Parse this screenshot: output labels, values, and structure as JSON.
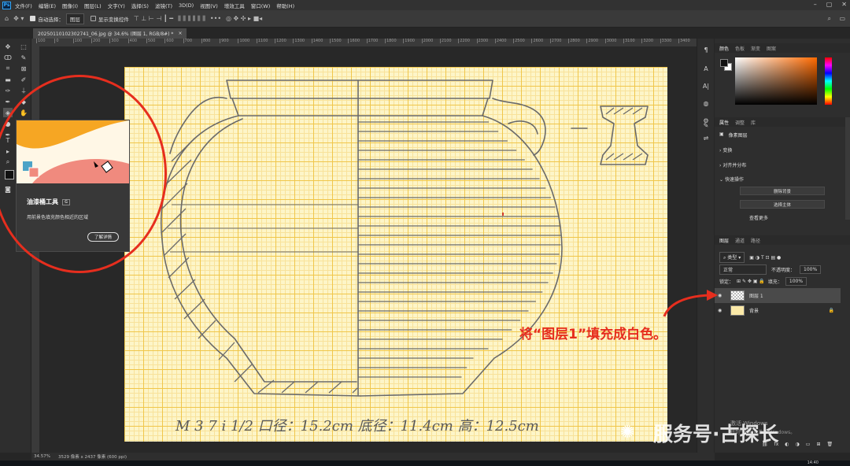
{
  "menu": {
    "items": [
      "文件(F)",
      "编辑(E)",
      "图像(I)",
      "图层(L)",
      "文字(Y)",
      "选择(S)",
      "滤镜(T)",
      "3D(D)",
      "视图(V)",
      "增效工具",
      "窗口(W)",
      "帮助(H)"
    ],
    "logo": "Ps"
  },
  "options": {
    "auto_select_label": "自动选择：",
    "auto_select_target": "图层",
    "show_transform_label": "显示变换控件"
  },
  "document": {
    "tab_title": "20250110102302741_06.jpg @ 34.6% (图层 1, RGB/8#) *",
    "close_glyph": "×",
    "ruler_ticks": [
      "100",
      "0",
      "100",
      "200",
      "300",
      "400",
      "500",
      "600",
      "700",
      "800",
      "900",
      "1000",
      "1100",
      "1200",
      "1300",
      "1400",
      "1500",
      "1600",
      "1700",
      "1800",
      "1900",
      "2000",
      "2100",
      "2200",
      "2300",
      "2400",
      "2500",
      "2600",
      "2700",
      "2800",
      "2900",
      "3000",
      "3100",
      "3200",
      "3300",
      "3400"
    ],
    "handwriting": "M 3 7 i 1/2   口径：15.2cm   底径：11.4cm   高：12.5cm"
  },
  "status": {
    "zoom": "34.57%",
    "size": "3529 像素 x 2437 像素 (600 ppi)"
  },
  "tooltip": {
    "title": "油漆桶工具",
    "shortcut": "G",
    "description": "用前景色填充颜色相近的区域",
    "learn_more": "了解详情"
  },
  "panels": {
    "color_tabs": [
      "颜色",
      "色板",
      "渐变",
      "图案"
    ],
    "properties_tabs": [
      "属性",
      "调整",
      "库"
    ],
    "pixel_layer_label": "像素图层",
    "transform_label": "变换",
    "align_label": "对齐并分布",
    "quick_actions_label": "快速操作",
    "btn_remove_bg": "删除背景",
    "btn_select_subject": "选择主体",
    "btn_view_more": "查看更多",
    "layer_tabs": [
      "图层",
      "通道",
      "路径"
    ],
    "kind_label": "类型",
    "blend_mode": "正常",
    "opacity_label": "不透明度：",
    "opacity_value": "100%",
    "lock_label": "锁定：",
    "fill_label": "填充：",
    "fill_value": "100%",
    "layers": [
      {
        "name": "图层 1",
        "selected": true
      },
      {
        "name": "背景",
        "selected": false
      }
    ]
  },
  "annotation": {
    "text": "将“图层1”填充成白色。",
    "color": "#e62e1e"
  },
  "watermark": {
    "text": "服务号·古探长"
  },
  "windows_activation": {
    "line1": "激活 Windows",
    "line2": "转到\"设置\"以激活 Windows。"
  },
  "taskbar": {
    "time": "14:40"
  }
}
